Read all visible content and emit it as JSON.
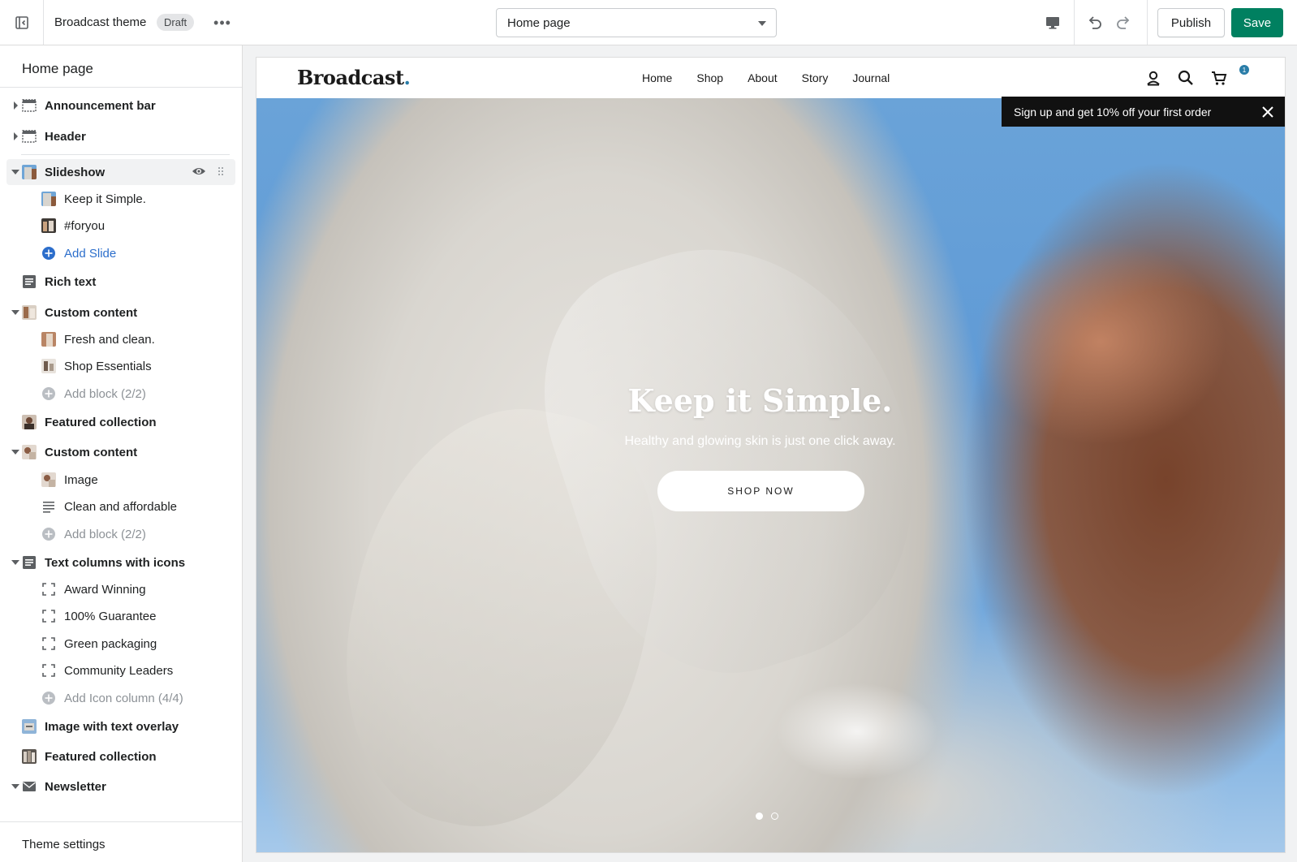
{
  "topbar": {
    "theme_name": "Broadcast theme",
    "status_badge": "Draft",
    "page_select_value": "Home page",
    "publish_label": "Publish",
    "save_label": "Save"
  },
  "sidebar": {
    "title": "Home page",
    "items": [
      {
        "label": "Announcement bar"
      },
      {
        "label": "Header"
      },
      {
        "label": "Slideshow"
      },
      {
        "label": "Keep it Simple."
      },
      {
        "label": "#foryou"
      },
      {
        "label": "Add Slide"
      },
      {
        "label": "Rich text"
      },
      {
        "label": "Custom content"
      },
      {
        "label": "Fresh and clean."
      },
      {
        "label": "Shop Essentials"
      },
      {
        "label": "Add block (2/2)"
      },
      {
        "label": "Featured collection"
      },
      {
        "label": "Custom content"
      },
      {
        "label": "Image"
      },
      {
        "label": "Clean and affordable"
      },
      {
        "label": "Add block (2/2)"
      },
      {
        "label": "Text columns with icons"
      },
      {
        "label": "Award Winning"
      },
      {
        "label": "100% Guarantee"
      },
      {
        "label": "Green packaging"
      },
      {
        "label": "Community Leaders"
      },
      {
        "label": "Add Icon column (4/4)"
      },
      {
        "label": "Image with text overlay"
      },
      {
        "label": "Featured collection"
      },
      {
        "label": "Newsletter"
      }
    ],
    "theme_settings": "Theme settings"
  },
  "preview": {
    "logo": "Broadcast",
    "nav": [
      "Home",
      "Shop",
      "About",
      "Story",
      "Journal"
    ],
    "cart_count": "1",
    "promo_text": "Sign up and get 10% off your first order",
    "hero_title": "Keep it Simple.",
    "hero_subtitle": "Healthy and glowing skin is just one click away.",
    "hero_button": "SHOP NOW"
  },
  "colors": {
    "save_green": "#008060",
    "accent_blue": "#2c6ecb",
    "brand_dot": "#2a7da8"
  }
}
